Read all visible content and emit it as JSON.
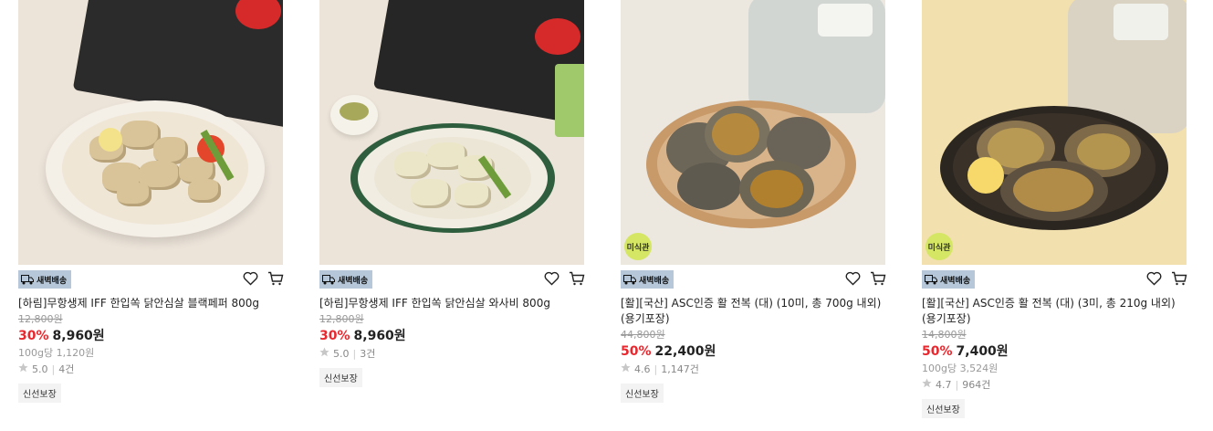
{
  "products": [
    {
      "badge": "새벽배송",
      "title": "[하림]무항생제 IFF 한입쏙 닭안심살 블랙페퍼 800g",
      "original_price": "12,800원",
      "discount": "30%",
      "price": "8,960원",
      "unit_price": "100g당 1,120원",
      "rating": "5.0",
      "reviews": "4건",
      "tag": "신선보장"
    },
    {
      "badge": "새벽배송",
      "title": "[하림]무항생제 IFF 한입쏙 닭안심살 와사비 800g",
      "original_price": "12,800원",
      "discount": "30%",
      "price": "8,960원",
      "rating": "5.0",
      "reviews": "3건",
      "tag": "신선보장"
    },
    {
      "badge": "새벽배송",
      "corner_badge": "미식관",
      "title": "[활][국산] ASC인증 활 전복 (대) (10미, 총 700g 내외)(용기포장)",
      "original_price": "44,800원",
      "discount": "50%",
      "price": "22,400원",
      "rating": "4.6",
      "reviews": "1,147건",
      "tag": "신선보장"
    },
    {
      "badge": "새벽배송",
      "corner_badge": "미식관",
      "title": "[활][국산] ASC인증 활 전복 (대) (3미, 총 210g 내외)(용기포장)",
      "original_price": "14,800원",
      "discount": "50%",
      "price": "7,400원",
      "unit_price": "100g당 3,524원",
      "rating": "4.7",
      "reviews": "964건",
      "tag": "신선보장"
    }
  ],
  "colors": {
    "discount": "#e8282e",
    "dawn_badge_bg": "#b5c7d8",
    "corner_badge_bg": "#d5e665"
  },
  "icons": {
    "wishlist": "heart-icon",
    "cart": "cart-icon",
    "rating": "star-icon",
    "delivery": "truck-icon"
  }
}
